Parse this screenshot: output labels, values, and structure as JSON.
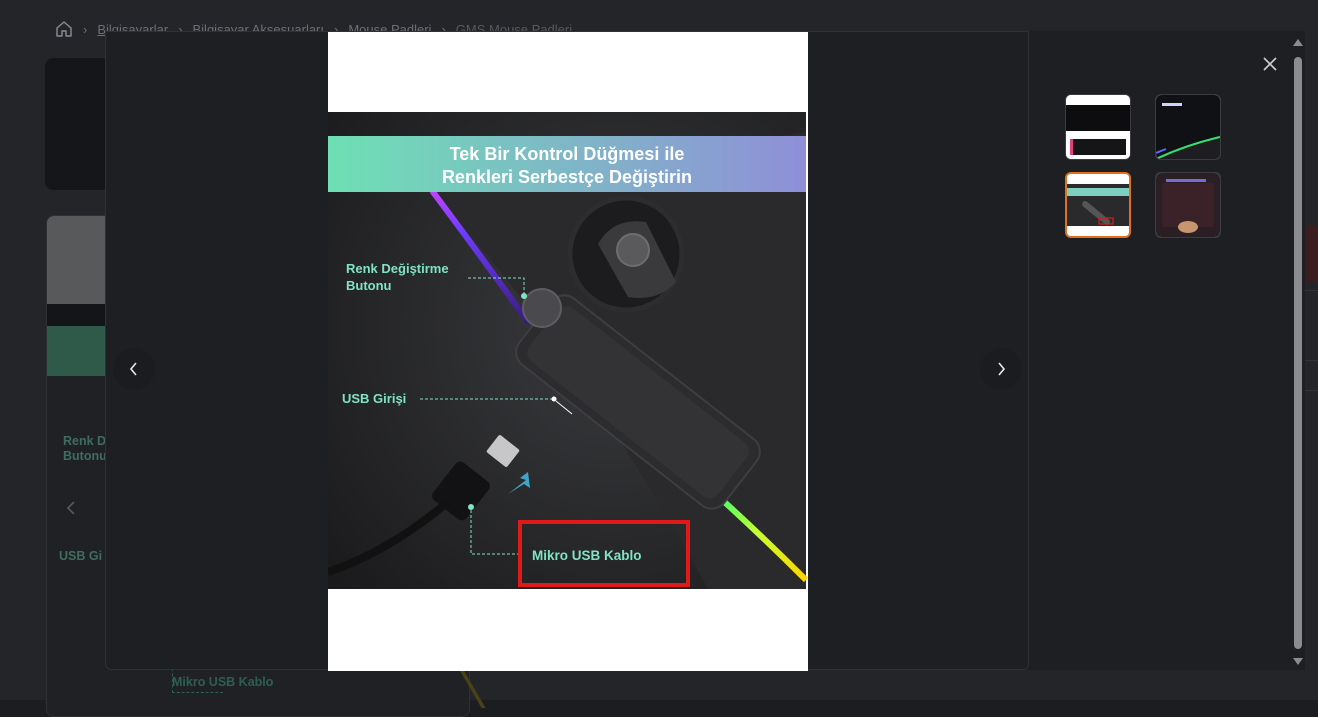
{
  "breadcrumb": {
    "items": [
      "Bilgisayarlar",
      "Bilgisayar Aksesuarları",
      "Mouse Padleri",
      "GMS Mouse Padleri"
    ]
  },
  "background_card": {
    "label_renk": "Renk D",
    "label_butonu": "Butonu",
    "label_usb": "USB Gi",
    "label_mikro": "Mikro USB Kablo"
  },
  "gallery": {
    "main_image": {
      "banner_line1": "Tek Bir Kontrol Düğmesi ile",
      "banner_line2": "Renkleri Serbestçe Değiştirin",
      "callout_button_line1": "Renk Değiştirme",
      "callout_button_line2": "Butonu",
      "callout_usb": "USB Girişi",
      "callout_cable": "Mikro USB Kablo"
    },
    "thumbnails": [
      {
        "id": "thumb-1",
        "active": false
      },
      {
        "id": "thumb-2",
        "active": false
      },
      {
        "id": "thumb-3",
        "active": true
      },
      {
        "id": "thumb-4",
        "active": false
      }
    ],
    "icons": {
      "prev": "chevron-left-icon",
      "next": "chevron-right-icon",
      "close": "close-icon",
      "home": "home-icon"
    }
  },
  "colors": {
    "banner_left": "#6ee0b4",
    "banner_right": "#8f8fd8",
    "callout_text": "#7fe3c4",
    "highlight_box": "#e01919",
    "active_thumb_border": "#e0701e"
  }
}
